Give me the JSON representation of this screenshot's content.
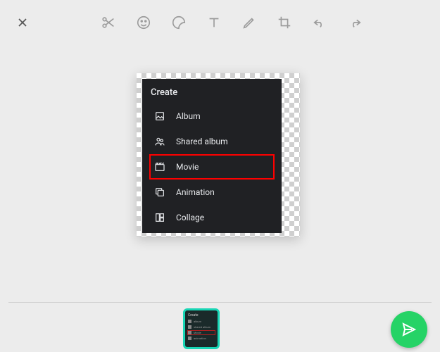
{
  "card": {
    "title": "Create",
    "items": [
      {
        "label": "Album",
        "icon": "image-icon",
        "highlighted": false
      },
      {
        "label": "Shared album",
        "icon": "shared-album-icon",
        "highlighted": false
      },
      {
        "label": "Movie",
        "icon": "movie-icon",
        "highlighted": true
      },
      {
        "label": "Animation",
        "icon": "animation-icon",
        "highlighted": false
      },
      {
        "label": "Collage",
        "icon": "collage-icon",
        "highlighted": false
      }
    ]
  },
  "thumb": {
    "title": "Create",
    "rows": [
      "album",
      "shared album",
      "Movie",
      "animation"
    ]
  }
}
